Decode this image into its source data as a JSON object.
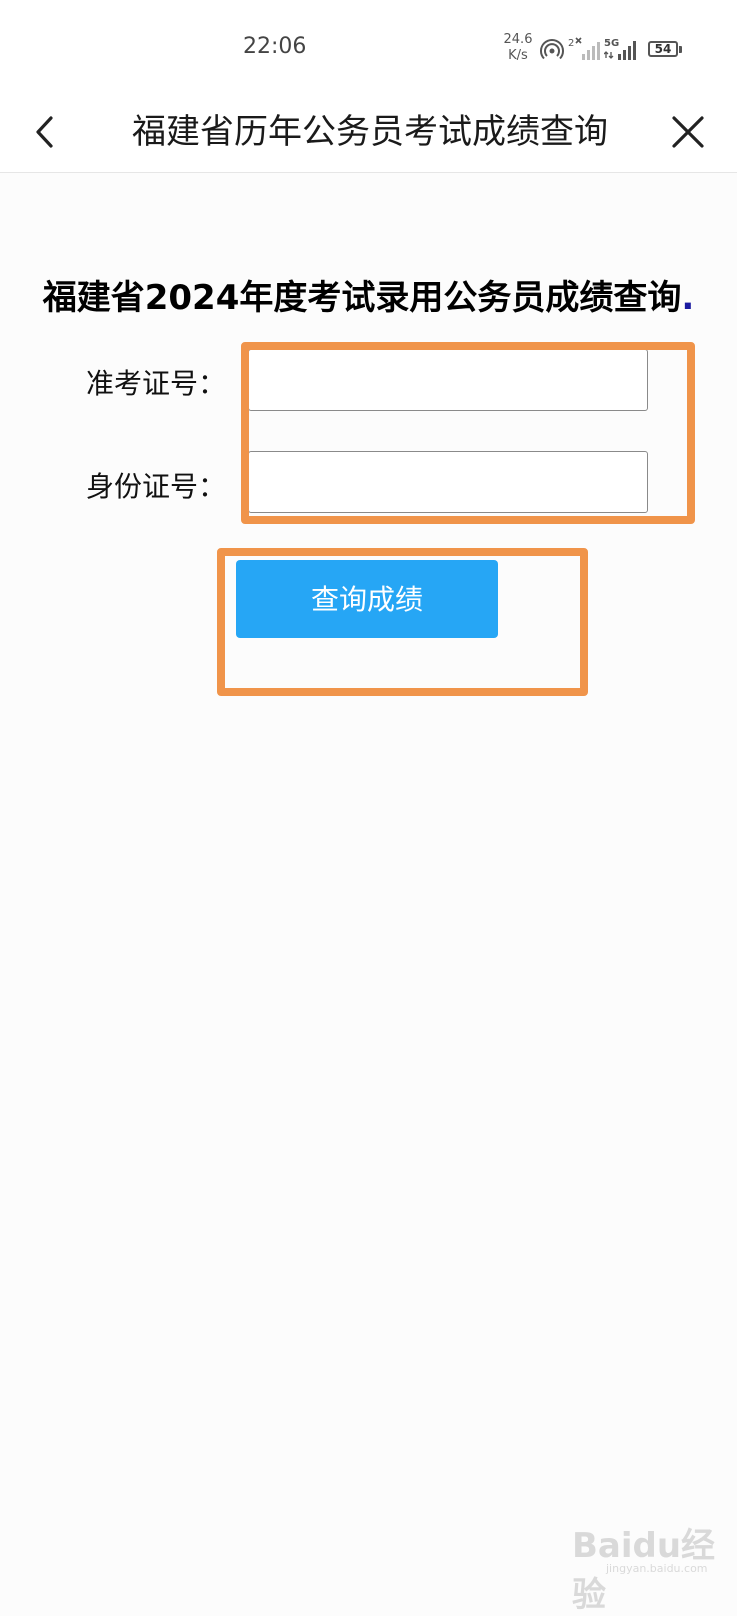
{
  "status_bar": {
    "time": "22:06",
    "net_speed_value": "24.6",
    "net_speed_unit": "K/s",
    "sim1_label": "2",
    "sim2_label": "5G",
    "battery_level": "54"
  },
  "nav": {
    "title": "福建省历年公务员考试成绩查询",
    "back_icon": "chevron-left-icon",
    "close_icon": "close-icon"
  },
  "form": {
    "heading": "福建省2024年度考试录用公务员成绩查询",
    "heading_dot": ".",
    "ticket_label": "准考证号：",
    "ticket_value": "",
    "id_label": "身份证号：",
    "id_value": "",
    "submit_label": "查询成绩"
  },
  "watermark": {
    "brand": "Baidu经验",
    "site": "jingyan.baidu.com"
  },
  "colors": {
    "highlight": "#f0944a",
    "button": "#26a6f5",
    "heading_dot": "#1a1aa0"
  }
}
